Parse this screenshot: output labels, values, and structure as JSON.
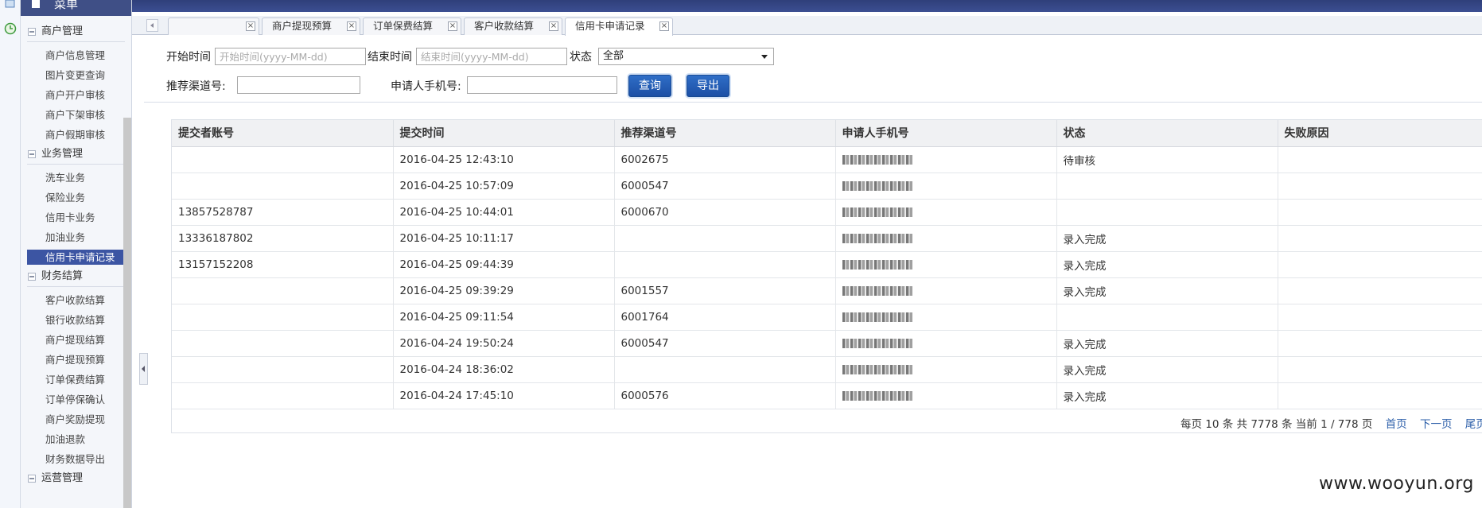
{
  "sidebar": {
    "title": "菜单",
    "groups": [
      {
        "label": "商户管理",
        "items": [
          "商户信息管理",
          "图片变更查询",
          "商户开户审核",
          "商户下架审核",
          "商户假期审核"
        ]
      },
      {
        "label": "业务管理",
        "items": [
          "洗车业务",
          "保险业务",
          "信用卡业务",
          "加油业务",
          "信用卡申请记录"
        ]
      },
      {
        "label": "财务结算",
        "items": [
          "客户收款结算",
          "银行收款结算",
          "商户提现结算",
          "商户提现预算",
          "订单保费结算",
          "订单停保确认",
          "商户奖励提现",
          "加油退款",
          "财务数据导出"
        ]
      },
      {
        "label": "运营管理",
        "items": []
      }
    ]
  },
  "tabs": [
    {
      "label": ""
    },
    {
      "label": "商户提现预算"
    },
    {
      "label": "订单保费结算"
    },
    {
      "label": "客户收款结算"
    },
    {
      "label": "信用卡申请记录"
    }
  ],
  "filters": {
    "start_label": "开始时间",
    "start_placeholder": "开始时间(yyyy-MM-dd)",
    "end_label": "结束时间",
    "end_placeholder": "结束时间(yyyy-MM-dd)",
    "status_label": "状态",
    "status_value": "全部",
    "channel_label": "推荐渠道号:",
    "channel_value": "",
    "phone_label": "申请人手机号:",
    "phone_value": "",
    "search_button": "查询",
    "export_button": "导出"
  },
  "table": {
    "columns": [
      "提交者账号",
      "提交时间",
      "推荐渠道号",
      "申请人手机号",
      "状态",
      "失败原因"
    ],
    "rows": [
      [
        "",
        "2016-04-25 12:43:10",
        "6002675",
        "",
        "待审核",
        ""
      ],
      [
        "",
        "2016-04-25 10:57:09",
        "6000547",
        "",
        "",
        ""
      ],
      [
        "13857528787",
        "2016-04-25 10:44:01",
        "6000670",
        "",
        "",
        ""
      ],
      [
        "13336187802",
        "2016-04-25 10:11:17",
        "",
        "",
        "录入完成",
        ""
      ],
      [
        "13157152208",
        "2016-04-25 09:44:39",
        "",
        "",
        "录入完成",
        ""
      ],
      [
        "",
        "2016-04-25 09:39:29",
        "6001557",
        "",
        "录入完成",
        ""
      ],
      [
        "",
        "2016-04-25 09:11:54",
        "6001764",
        "",
        "",
        ""
      ],
      [
        "",
        "2016-04-24 19:50:24",
        "6000547",
        "",
        "录入完成",
        ""
      ],
      [
        "",
        "2016-04-24 18:36:02",
        "",
        "",
        "录入完成",
        ""
      ],
      [
        "",
        "2016-04-24 17:45:10",
        "6000576",
        "",
        "录入完成",
        ""
      ]
    ]
  },
  "pagination": {
    "summary": "每页 10 条  共 7778 条  当前 1 / 778 页",
    "first": "首页",
    "next": "下一页",
    "last": "尾页"
  },
  "watermark": "www.wooyun.org"
}
